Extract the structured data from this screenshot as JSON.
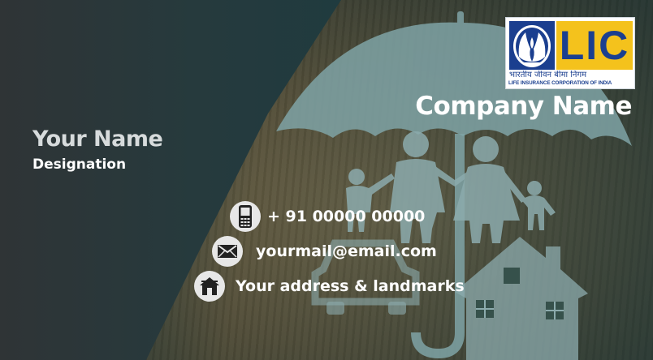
{
  "card": {
    "company_name": "Company Name",
    "person_name": "Your Name",
    "designation": "Designation"
  },
  "logo": {
    "brand": "LIC",
    "hindi_text": "भारतीय जीवन बीमा निगम",
    "english_text": "LIFE INSURANCE CORPORATION OF INDIA"
  },
  "contact": {
    "phone": "+ 91 00000 00000",
    "email": "yourmail@email.com",
    "address": "Your address & landmarks"
  },
  "icons": {
    "phone": "mobile-phone-icon",
    "email": "envelope-icon",
    "address": "house-icon"
  },
  "colors": {
    "background_dark": "#2f3436",
    "teal": "#1d4045",
    "lic_blue": "#1b3f8f",
    "lic_yellow": "#f4c21c",
    "text": "#ffffff"
  }
}
